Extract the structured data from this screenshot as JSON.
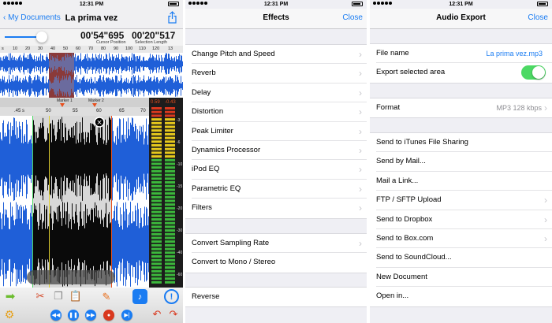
{
  "status": {
    "time": "12:31 PM"
  },
  "editor": {
    "back_label": "My Documents",
    "title": "La prima vez",
    "cursor_position": "00'54\"695",
    "cursor_position_label": "Cursor Position",
    "selection_length": "00'20\"517",
    "selection_length_label": "Selection Length",
    "ruler_ticks": [
      "s",
      "10",
      "20",
      "30",
      "40",
      "50",
      "60",
      "70",
      "80",
      "90",
      "100",
      "110",
      "120",
      "13"
    ],
    "marker_1": "Marker 1",
    "marker_2": "Marker 2",
    "zoom_ticks": [
      ".45 s",
      "50",
      "55",
      "60",
      "65",
      "70"
    ],
    "meter_left": "0.59",
    "meter_right": "-0.43",
    "meter_ticks": [
      "-3",
      "-6",
      "-10",
      "-15",
      "-20",
      "-30",
      "-40",
      "-60"
    ]
  },
  "effects": {
    "title": "Effects",
    "close_label": "Close",
    "group1": [
      "Change Pitch and Speed",
      "Reverb",
      "Delay",
      "Distortion",
      "Peak Limiter",
      "Dynamics Processor",
      "iPod EQ",
      "Parametric EQ",
      "Filters"
    ],
    "group2": [
      "Convert Sampling Rate",
      "Convert to Mono / Stereo"
    ],
    "group3": [
      "Reverse"
    ]
  },
  "export": {
    "title": "Audio Export",
    "close_label": "Close",
    "file_name_label": "File name",
    "file_name_value": "La prima vez.mp3",
    "export_selected_label": "Export selected area",
    "export_selected_on": true,
    "format_label": "Format",
    "format_value": "MP3 128 kbps",
    "destinations": [
      "Send to iTunes File Sharing",
      "Send by Mail...",
      "Mail a Link...",
      "FTP / SFTP Upload",
      "Send to Dropbox",
      "Send to Box.com",
      "Send to SoundCloud...",
      "New Document",
      "Open in..."
    ]
  },
  "colors": {
    "accent": "#1a7cf2",
    "toggle_on": "#4cd964",
    "waveform": "#1f5fd8",
    "waveform_selected": "#0a0a0a",
    "selection": "#8a3a3a",
    "marker": "#e8501e"
  }
}
